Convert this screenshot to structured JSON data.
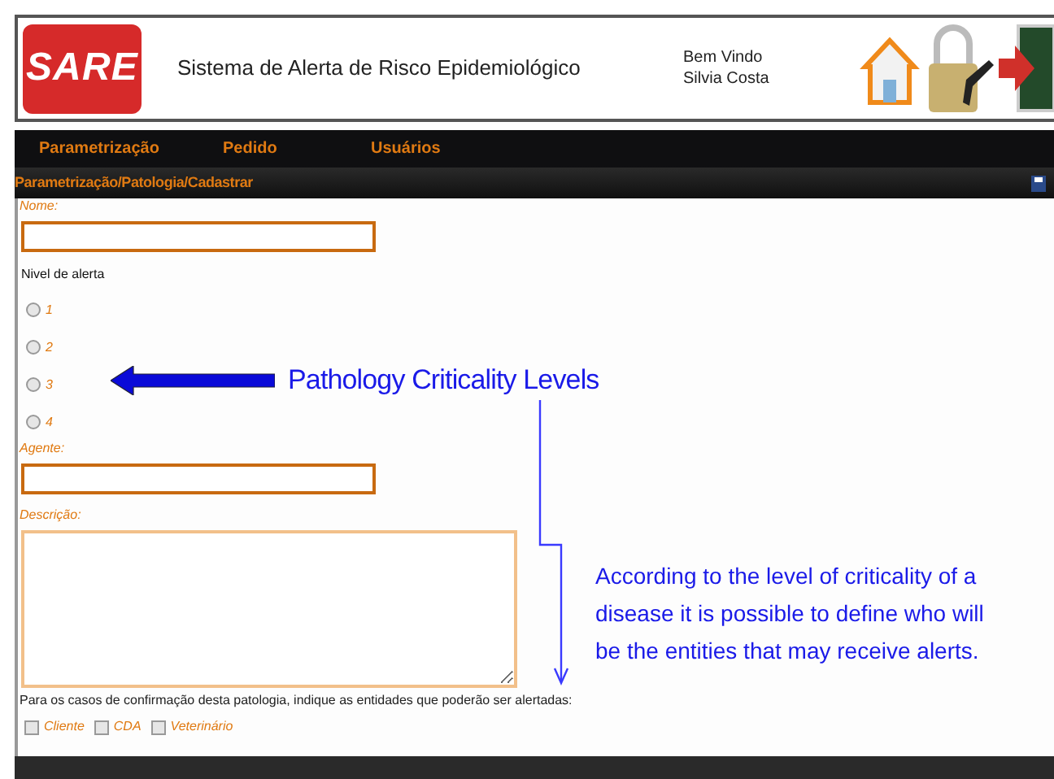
{
  "header": {
    "logo": "SARE",
    "title": "Sistema de Alerta de Risco Epidemiológico",
    "welcome": "Bem Vindo",
    "user": "Silvia Costa"
  },
  "nav": {
    "items": [
      {
        "label": "Parametrização"
      },
      {
        "label": "Pedido"
      },
      {
        "label": "Usuários"
      }
    ]
  },
  "breadcrumb": "Parametrização/Patologia/Cadastrar",
  "form": {
    "name_label": "Nome:",
    "level_label": "Nivel de alerta",
    "levels": [
      {
        "label": "1",
        "selected": false
      },
      {
        "label": "2",
        "selected": false
      },
      {
        "label": "3",
        "selected": false
      },
      {
        "label": "4",
        "selected": false
      }
    ],
    "agent_label": "Agente:",
    "description_label": "Descrição:",
    "entities_label": "Para os casos de confirmação desta patologia, indique as entidades que poderão ser alertadas:",
    "entities": [
      {
        "label": "Cliente",
        "checked": false
      },
      {
        "label": "CDA",
        "checked": false
      },
      {
        "label": "Veterinário",
        "checked": false
      }
    ]
  },
  "annotations": [
    {
      "kind": "arrow",
      "text": "Pathology Criticality Levels"
    },
    {
      "kind": "connector",
      "text": "According to the level of criticality of a disease it is possible to define who will be the entities that may receive alerts."
    }
  ]
}
